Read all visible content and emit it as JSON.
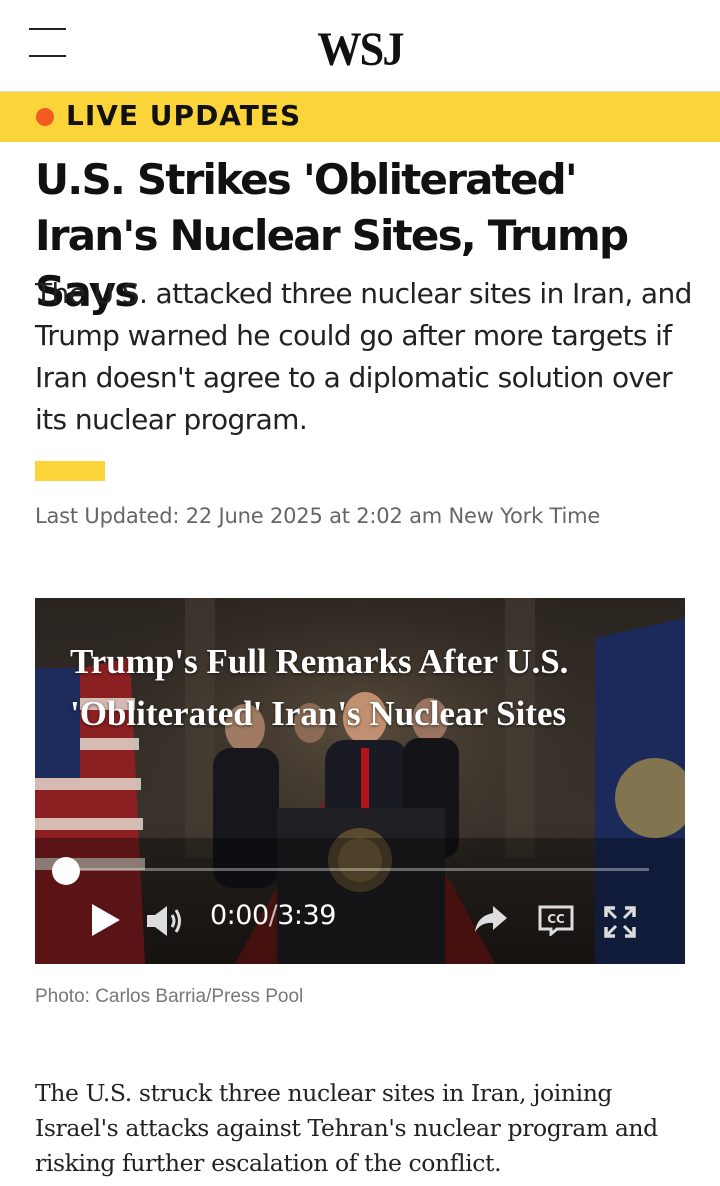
{
  "header": {
    "logo": "WSJ",
    "menu_icon": "hamburger-menu-icon"
  },
  "banner": {
    "label": "LIVE UPDATES",
    "dot_color": "#f25c22",
    "background_color": "#fbd43a"
  },
  "article": {
    "headline": "U.S. Strikes 'Obliterated' Iran's Nuclear Sites, Trump Says",
    "dek": "The U.S. attacked three nuclear sites in Iran, and Trump warned he could go after more targets if Iran doesn't agree to a diplomatic solution over its nuclear program.",
    "last_updated": "Last Updated: 22 June 2025 at 2:02 am New York Time",
    "body": "The U.S. struck three nuclear sites in Iran, joining Israel's attacks against Tehran's nuclear program and risking further escalation of the conflict."
  },
  "video": {
    "title": "Trump's Full Remarks After U.S. 'Obliterated' Iran's Nuclear Sites",
    "current_time": "0:00",
    "duration": "3:39",
    "progress": 0,
    "controls": {
      "play_icon": "play-icon",
      "volume_icon": "volume-icon",
      "share_icon": "share-icon",
      "cc_icon": "closed-captions-icon",
      "fullscreen_icon": "fullscreen-icon"
    }
  },
  "photo_credit": "Photo: Carlos Barria/Press Pool"
}
